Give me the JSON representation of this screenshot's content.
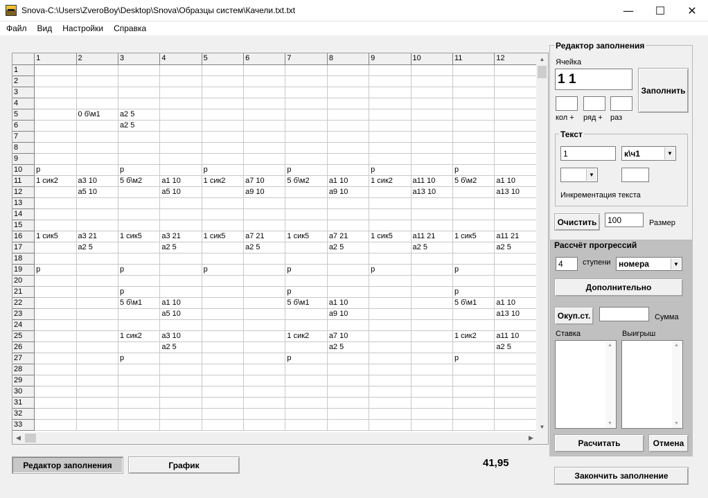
{
  "window": {
    "title": "Snova-C:\\Users\\ZveroBoy\\Desktop\\Snova\\Образцы систем\\Качели.txt.txt",
    "minimize": "—",
    "maximize": "☐",
    "close": "✕"
  },
  "menu": [
    "Файл",
    "Вид",
    "Настройки",
    "Справка"
  ],
  "grid": {
    "columns": [
      "1",
      "2",
      "3",
      "4",
      "5",
      "6",
      "7",
      "8",
      "9",
      "10",
      "11",
      "12"
    ],
    "rows": [
      {
        "n": "1",
        "c": [
          "",
          "",
          "",
          "",
          "",
          "",
          "",
          "",
          "",
          "",
          "",
          ""
        ]
      },
      {
        "n": "2",
        "c": [
          "",
          "",
          "",
          "",
          "",
          "",
          "",
          "",
          "",
          "",
          "",
          ""
        ]
      },
      {
        "n": "3",
        "c": [
          "",
          "",
          "",
          "",
          "",
          "",
          "",
          "",
          "",
          "",
          "",
          ""
        ]
      },
      {
        "n": "4",
        "c": [
          "",
          "",
          "",
          "",
          "",
          "",
          "",
          "",
          "",
          "",
          "",
          ""
        ]
      },
      {
        "n": "5",
        "c": [
          "",
          "0 б\\м1",
          "а2 5",
          "",
          "",
          "",
          "",
          "",
          "",
          "",
          "",
          ""
        ]
      },
      {
        "n": "6",
        "c": [
          "",
          "",
          "а2 5",
          "",
          "",
          "",
          "",
          "",
          "",
          "",
          "",
          ""
        ]
      },
      {
        "n": "7",
        "c": [
          "",
          "",
          "",
          "",
          "",
          "",
          "",
          "",
          "",
          "",
          "",
          ""
        ]
      },
      {
        "n": "8",
        "c": [
          "",
          "",
          "",
          "",
          "",
          "",
          "",
          "",
          "",
          "",
          "",
          ""
        ]
      },
      {
        "n": "9",
        "c": [
          "",
          "",
          "",
          "",
          "",
          "",
          "",
          "",
          "",
          "",
          "",
          ""
        ]
      },
      {
        "n": "10",
        "c": [
          "р",
          "",
          "р",
          "",
          "р",
          "",
          "р",
          "",
          "р",
          "",
          "р",
          ""
        ]
      },
      {
        "n": "11",
        "c": [
          "1 сик2",
          "а3 10",
          "5 б\\м2",
          "а1 10",
          "1 сик2",
          "а7 10",
          "5 б\\м2",
          "а1 10",
          "1 сик2",
          "а11 10",
          "5 б\\м2",
          "а1 10"
        ]
      },
      {
        "n": "12",
        "c": [
          "",
          "а5 10",
          "",
          "а5 10",
          "",
          "а9 10",
          "",
          "а9 10",
          "",
          "а13 10",
          "",
          "а13 10"
        ]
      },
      {
        "n": "13",
        "c": [
          "",
          "",
          "",
          "",
          "",
          "",
          "",
          "",
          "",
          "",
          "",
          ""
        ]
      },
      {
        "n": "14",
        "c": [
          "",
          "",
          "",
          "",
          "",
          "",
          "",
          "",
          "",
          "",
          "",
          ""
        ]
      },
      {
        "n": "15",
        "c": [
          "",
          "",
          "",
          "",
          "",
          "",
          "",
          "",
          "",
          "",
          "",
          ""
        ]
      },
      {
        "n": "16",
        "c": [
          "1 сик5",
          "а3 21",
          "1 сик5",
          "а3 21",
          "1 сик5",
          "а7 21",
          "1 сик5",
          "а7 21",
          "1 сик5",
          "а11 21",
          "1 сик5",
          "а11 21"
        ]
      },
      {
        "n": "17",
        "c": [
          "",
          "а2 5",
          "",
          "а2 5",
          "",
          "а2 5",
          "",
          "а2 5",
          "",
          "а2 5",
          "",
          "а2 5"
        ]
      },
      {
        "n": "18",
        "c": [
          "",
          "",
          "",
          "",
          "",
          "",
          "",
          "",
          "",
          "",
          "",
          ""
        ]
      },
      {
        "n": "19",
        "c": [
          "р",
          "",
          "р",
          "",
          "р",
          "",
          "р",
          "",
          "р",
          "",
          "р",
          ""
        ]
      },
      {
        "n": "20",
        "c": [
          "",
          "",
          "",
          "",
          "",
          "",
          "",
          "",
          "",
          "",
          "",
          ""
        ]
      },
      {
        "n": "21",
        "c": [
          "",
          "",
          "р",
          "",
          "",
          "",
          "р",
          "",
          "",
          "",
          "р",
          ""
        ]
      },
      {
        "n": "22",
        "c": [
          "",
          "",
          "5 б\\м1",
          "а1 10",
          "",
          "",
          "5 б\\м1",
          "а1 10",
          "",
          "",
          "5 б\\м1",
          "а1 10"
        ]
      },
      {
        "n": "23",
        "c": [
          "",
          "",
          "",
          "а5 10",
          "",
          "",
          "",
          "а9 10",
          "",
          "",
          "",
          "а13 10"
        ]
      },
      {
        "n": "24",
        "c": [
          "",
          "",
          "",
          "",
          "",
          "",
          "",
          "",
          "",
          "",
          "",
          ""
        ]
      },
      {
        "n": "25",
        "c": [
          "",
          "",
          "1 сик2",
          "а3 10",
          "",
          "",
          "1 сик2",
          "а7 10",
          "",
          "",
          "1 сик2",
          "а11 10"
        ]
      },
      {
        "n": "26",
        "c": [
          "",
          "",
          "",
          "а2 5",
          "",
          "",
          "",
          "а2 5",
          "",
          "",
          "",
          "а2 5"
        ]
      },
      {
        "n": "27",
        "c": [
          "",
          "",
          "р",
          "",
          "",
          "",
          "р",
          "",
          "",
          "",
          "р",
          ""
        ]
      },
      {
        "n": "28",
        "c": [
          "",
          "",
          "",
          "",
          "",
          "",
          "",
          "",
          "",
          "",
          "",
          ""
        ]
      },
      {
        "n": "29",
        "c": [
          "",
          "",
          "",
          "",
          "",
          "",
          "",
          "",
          "",
          "",
          "",
          ""
        ]
      },
      {
        "n": "30",
        "c": [
          "",
          "",
          "",
          "",
          "",
          "",
          "",
          "",
          "",
          "",
          "",
          ""
        ]
      },
      {
        "n": "31",
        "c": [
          "",
          "",
          "",
          "",
          "",
          "",
          "",
          "",
          "",
          "",
          "",
          ""
        ]
      },
      {
        "n": "32",
        "c": [
          "",
          "",
          "",
          "",
          "",
          "",
          "",
          "",
          "",
          "",
          "",
          ""
        ]
      },
      {
        "n": "33",
        "c": [
          "",
          "",
          "",
          "",
          "",
          "",
          "",
          "",
          "",
          "",
          "",
          ""
        ]
      }
    ]
  },
  "editor": {
    "title": "Редактор заполнения",
    "cell_label": "Ячейка",
    "cell_value": "1 1",
    "fill_button": "Заполнить",
    "col_plus_label": "кол +",
    "row_plus_label": "ряд +",
    "times_label": "раз",
    "text_group_title": "Текст",
    "text_value": "1",
    "text_select": "к\\ч1",
    "increment_label": "Инкрементация текста",
    "clear_button": "Очистить",
    "size_value": "100",
    "size_label": "Размер"
  },
  "progress": {
    "title": "Рассчёт прогрессий",
    "steps_value": "4",
    "steps_label": "ступени",
    "mode_select": "номера",
    "extra_button": "Дополнительно",
    "okup_button": "Окуп.ст.",
    "sum_label": "Сумма",
    "bet_label": "Ставка",
    "win_label": "Выигрыш",
    "calc_button": "Расчитать",
    "cancel_button": "Отмена"
  },
  "bottom": {
    "editor_tab": "Редактор заполнения",
    "chart_tab": "График",
    "total": "41,95",
    "finish_button": "Закончить заполнение"
  }
}
